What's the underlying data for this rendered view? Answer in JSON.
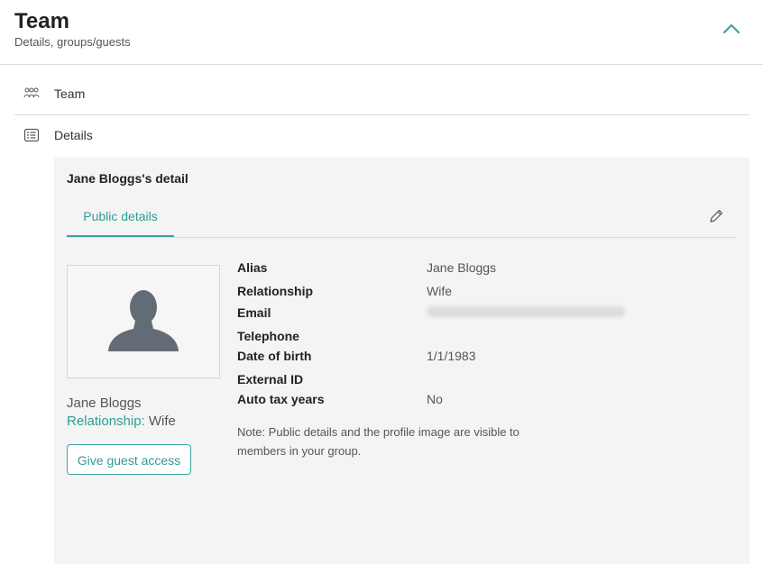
{
  "header": {
    "title": "Team",
    "subtitle": "Details, groups/guests",
    "collapse_icon": "chevron-up-icon"
  },
  "nav": {
    "team_label": "Team",
    "team_icon": "people-icon",
    "details_label": "Details",
    "details_icon": "list-icon"
  },
  "panel": {
    "title": "Jane Bloggs's detail",
    "tab_public": "Public details",
    "edit_icon": "pencil-icon"
  },
  "card": {
    "name": "Jane Bloggs",
    "relationship_label": "Relationship:",
    "relationship_value": "Wife",
    "guest_button": "Give guest access",
    "avatar_icon": "person-silhouette-icon"
  },
  "fields": {
    "alias_label": "Alias",
    "alias_value": "Jane Bloggs",
    "relationship_label": "Relationship",
    "relationship_value": "Wife",
    "email_label": "Email",
    "telephone_label": "Telephone",
    "dob_label": "Date of birth",
    "dob_value": "1/1/1983",
    "external_id_label": "External ID",
    "auto_tax_label": "Auto tax years",
    "auto_tax_value": "No"
  },
  "note": "Note: Public details and the profile image are visible to members in your group.",
  "colors": {
    "accent": "#3aa79e",
    "panel_bg": "#f4f4f4",
    "avatar": "#636b77"
  }
}
